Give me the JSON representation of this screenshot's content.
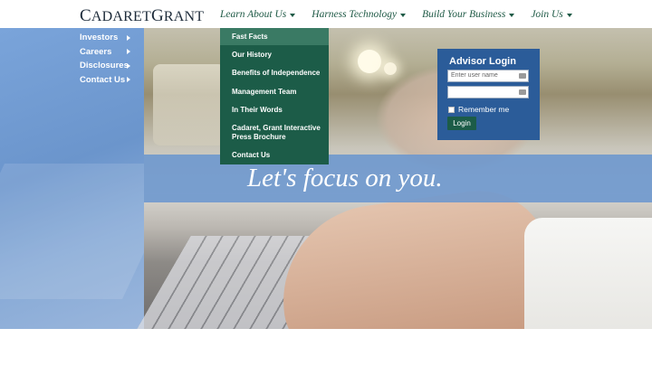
{
  "header": {
    "logo_part1": "C",
    "logo_part2": "ADARET",
    "logo_part3": "G",
    "logo_part4": "RANT",
    "nav": [
      {
        "label": "Learn About Us"
      },
      {
        "label": "Harness Technology"
      },
      {
        "label": "Build Your Business"
      },
      {
        "label": "Join Us"
      }
    ]
  },
  "dropdown": {
    "items": [
      {
        "label": "Fast Facts"
      },
      {
        "label": "Our History"
      },
      {
        "label": "Benefits of Independence"
      },
      {
        "label": "Management Team"
      },
      {
        "label": "In Their Words"
      },
      {
        "label": "Cadaret, Grant Interactive Press Brochure"
      },
      {
        "label": "Contact Us"
      }
    ]
  },
  "sidenav": {
    "items": [
      {
        "label": "Investors"
      },
      {
        "label": "Careers"
      },
      {
        "label": "Disclosures"
      },
      {
        "label": "Contact Us"
      }
    ]
  },
  "hero": {
    "tagline": "Let's focus on you."
  },
  "login": {
    "title": "Advisor Login",
    "username_placeholder": "Enter user name",
    "password_placeholder": "",
    "remember_label": "Remember me",
    "button_label": "Login"
  },
  "colors": {
    "nav_text": "#1f5a46",
    "dropdown_bg": "#1c5c48",
    "login_bg": "#2b5c99",
    "hero_blue": "#6f9bd2"
  }
}
